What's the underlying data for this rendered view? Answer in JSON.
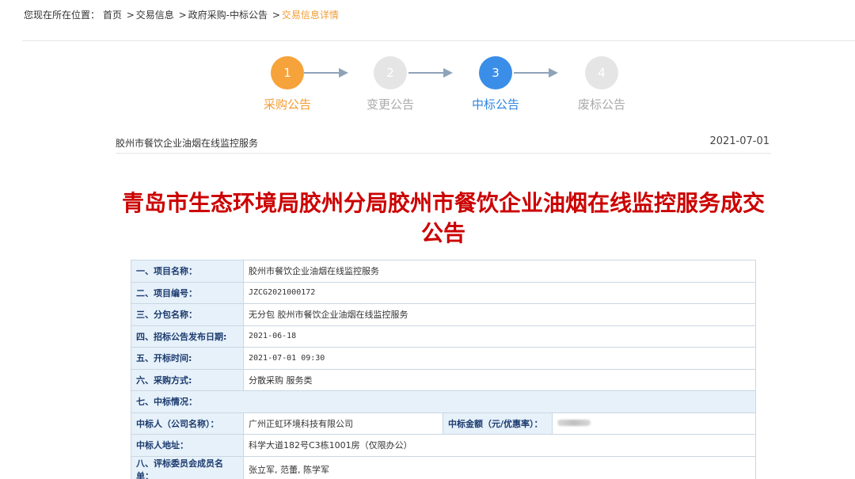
{
  "breadcrumb": {
    "prefix": "您现在所在位置：",
    "items": [
      "首页",
      "交易信息",
      "政府采购-中标公告",
      "交易信息详情"
    ],
    "sep": ">"
  },
  "steps": [
    {
      "num": "1",
      "label": "采购公告",
      "state": "orange"
    },
    {
      "num": "2",
      "label": "变更公告",
      "state": "gray"
    },
    {
      "num": "3",
      "label": "中标公告",
      "state": "blue"
    },
    {
      "num": "4",
      "label": "废标公告",
      "state": "gray"
    }
  ],
  "info": {
    "project": "胶州市餐饮企业油烟在线监控服务",
    "date": "2021-07-01"
  },
  "title": {
    "line1": "青岛市生态环境局胶州分局胶州市餐饮企业油烟在线监控服务成交",
    "line2": "公告"
  },
  "table": {
    "rows": [
      {
        "label": "一、项目名称：",
        "value": "胶州市餐饮企业油烟在线监控服务"
      },
      {
        "label": "二、项目编号：",
        "value": "JZCG2021000172"
      },
      {
        "label": "三、分包名称：",
        "value": "无分包 胶州市餐饮企业油烟在线监控服务"
      },
      {
        "label": "四、招标公告发布日期:",
        "value": "2021-06-18"
      },
      {
        "label": "五、开标时间:",
        "value": "2021-07-01 09:30"
      },
      {
        "label": "六、采购方式:",
        "value": "分散采购 服务类"
      }
    ],
    "section7": "七、中标情况：",
    "winner_label": "中标人（公司名称）：",
    "winner_value": "广州正虹环境科技有限公司",
    "amount_label": "中标金额（元/优惠率）：",
    "address_label": "中标人地址：",
    "address_value": "科学大道182号C3栋1001房（仅限办公）",
    "committee_label": "八、评标委员会成员名单：",
    "committee_value": "张立军, 范蕾, 陈学军"
  },
  "colors": {
    "orange": "#f6a33b",
    "blue": "#3a8ee8",
    "gray": "#e5e5e5",
    "title_red": "#cc0000"
  }
}
